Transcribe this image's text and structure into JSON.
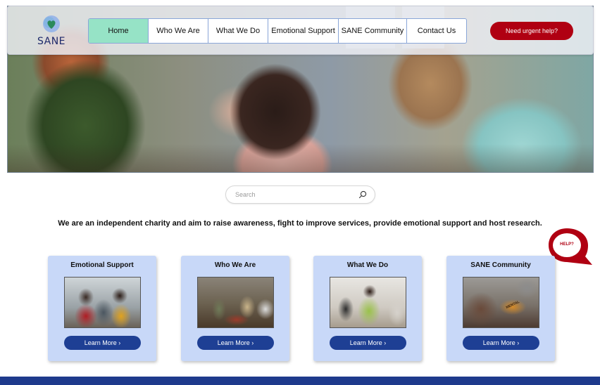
{
  "brand": {
    "name": "SANE",
    "accent": "#1f2a6b",
    "heart_color": "#2a8a5a"
  },
  "nav": {
    "items": [
      {
        "label": "Home",
        "active": true
      },
      {
        "label": "Who We Are",
        "active": false
      },
      {
        "label": "What We Do",
        "active": false
      },
      {
        "label": "Emotional Support",
        "active": false
      },
      {
        "label": "SANE Community",
        "active": false
      },
      {
        "label": "Contact Us",
        "active": false
      }
    ],
    "active_color": "#96e3c6"
  },
  "urgent_button": {
    "label": "Need urgent help?",
    "color": "#b00012"
  },
  "hero": {
    "image": "group-support-session-photo"
  },
  "search": {
    "placeholder": "Search",
    "icon": "search-icon"
  },
  "tagline": "We are an independent charity and aim to raise awareness, fight to improve services, provide emotional support and host research.",
  "help_bubble": {
    "label": "HELP?",
    "color": "#b00012"
  },
  "cards": [
    {
      "title": "Emotional Support",
      "button": "Learn More ›",
      "image": "support-group-photo"
    },
    {
      "title": "Who We Are",
      "button": "Learn More ›",
      "image": "group-meeting-photo"
    },
    {
      "title": "What We Do",
      "button": "Learn More ›",
      "image": "counselling-session-photo"
    },
    {
      "title": "SANE Community",
      "button": "Learn More ›",
      "image": "mental-health-book-photo"
    }
  ],
  "photo_text": {
    "book_cover": "MENTAL"
  },
  "colors": {
    "card_bg": "#c8d8f8",
    "button_bg": "#1e3f94",
    "footer": "#1e3a8c"
  }
}
